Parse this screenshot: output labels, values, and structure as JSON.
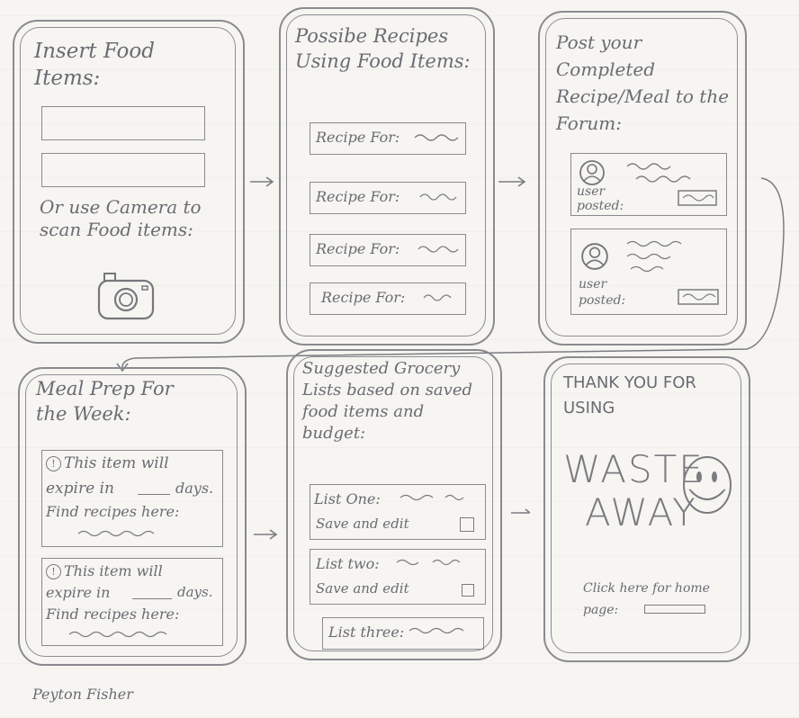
{
  "screens": {
    "s1": {
      "title": "Insert Food Items:",
      "camera_prompt": "Or use Camera to scan Food items:"
    },
    "s2": {
      "title": "Possibe Recipes Using Food Items:",
      "items": [
        "Recipe For:",
        "Recipe For:",
        "Recipe For:",
        "Recipe For:"
      ]
    },
    "s3": {
      "title": "Post your Completed Recipe/Meal to the Forum:",
      "posts": [
        "user posted:",
        "user posted:"
      ]
    },
    "s4": {
      "title": "Meal Prep For the Week:",
      "alert_line1": "This item will",
      "alert_line2": "expire in",
      "alert_days": "days.",
      "alert_line3": "Find recipes here:"
    },
    "s5": {
      "title": "Suggested Grocery Lists based on saved food items and budget:",
      "lists": [
        {
          "name": "List One:",
          "action": "Save and edit"
        },
        {
          "name": "List two:",
          "action": "Save and edit"
        },
        {
          "name": "List three:",
          "action": ""
        }
      ]
    },
    "s6": {
      "thanks": "THANK YOU FOR USING",
      "brand_line1": "WASTE",
      "brand_line2": "AWAY",
      "home_prompt": "Click here for home page:"
    }
  },
  "author": "Peyton Fisher",
  "icons": [
    "camera-icon",
    "user-avatar-icon",
    "smiley-face-icon",
    "alert-icon",
    "checkbox-icon"
  ]
}
